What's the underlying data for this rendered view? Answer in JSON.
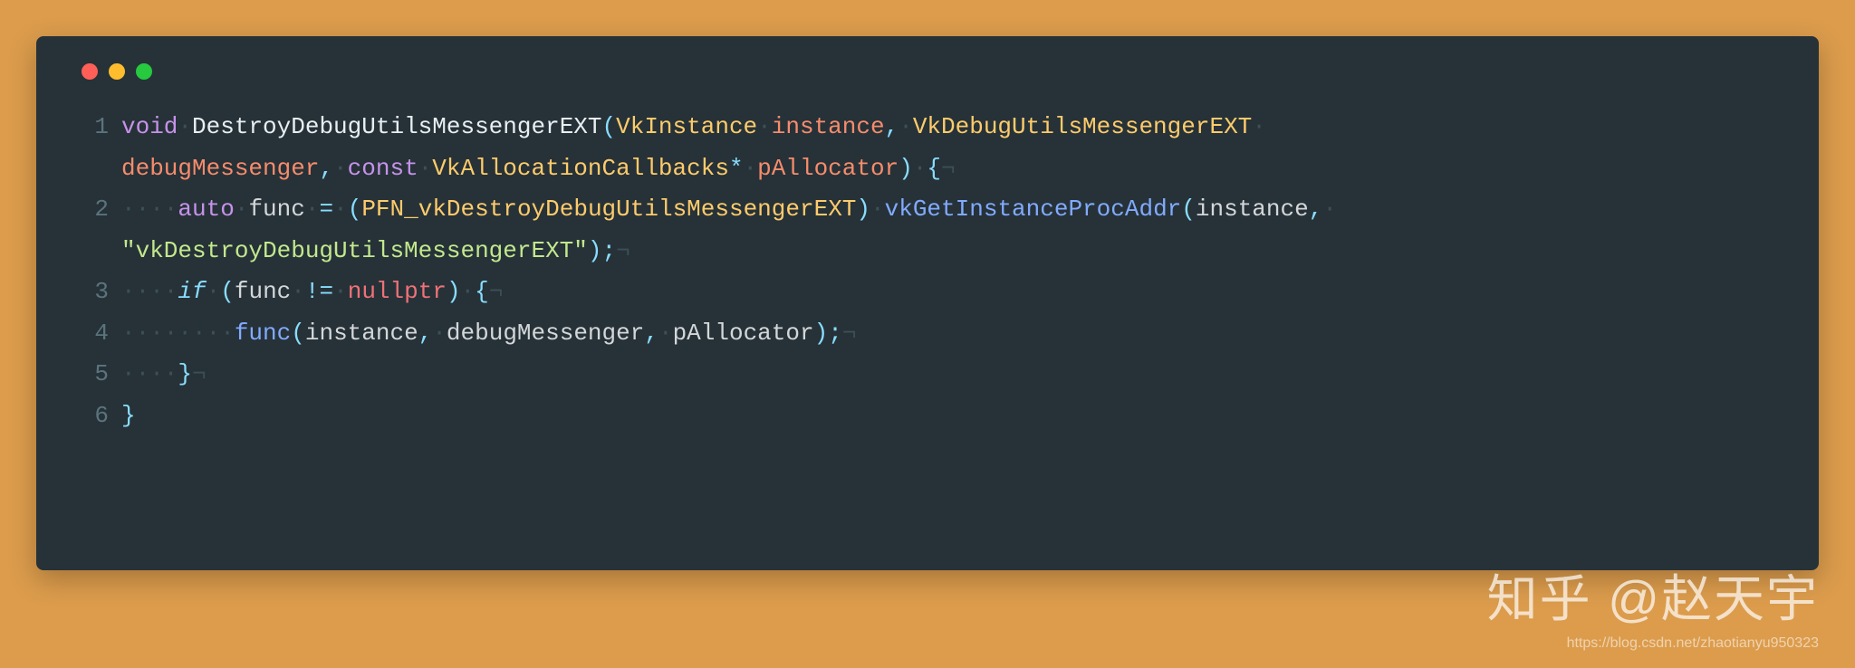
{
  "window": {
    "dots": [
      "red",
      "yellow",
      "green"
    ]
  },
  "tokens": {
    "void": "void",
    "fnName": "DestroyDebugUtilsMessengerEXT",
    "typeVkInstance": "VkInstance",
    "paramInstance": "instance",
    "typeVkDebugMessenger": "VkDebugUtilsMessengerEXT",
    "paramDebugMessenger": "debugMessenger",
    "const": "const",
    "typeVkAllocCallbacks": "VkAllocationCallbacks",
    "star": "*",
    "paramPAllocator": "pAllocator",
    "lbrace": "{",
    "rbrace": "}",
    "lparen": "(",
    "rparen": ")",
    "comma": ",",
    "semicolon": ";",
    "auto": "auto",
    "varFunc": "func",
    "assign": "=",
    "typePFN": "PFN_vkDestroyDebugUtilsMessengerEXT",
    "fnVkGetProcAddr": "vkGetInstanceProcAddr",
    "strVkDestroy": "\"vkDestroyDebugUtilsMessengerEXT\"",
    "if": "if",
    "neq": "!=",
    "nullptr": "nullptr",
    "ws1": "·",
    "ws4": "····",
    "ws8": "········",
    "eol": "¬"
  },
  "lineNumbers": {
    "l1": "1",
    "l2": "2",
    "l3": "3",
    "l4": "4",
    "l5": "5",
    "l6": "6"
  },
  "watermark": {
    "main": "知乎 @赵天宇",
    "url": "https://blog.csdn.net/zhaotianyu950323"
  }
}
